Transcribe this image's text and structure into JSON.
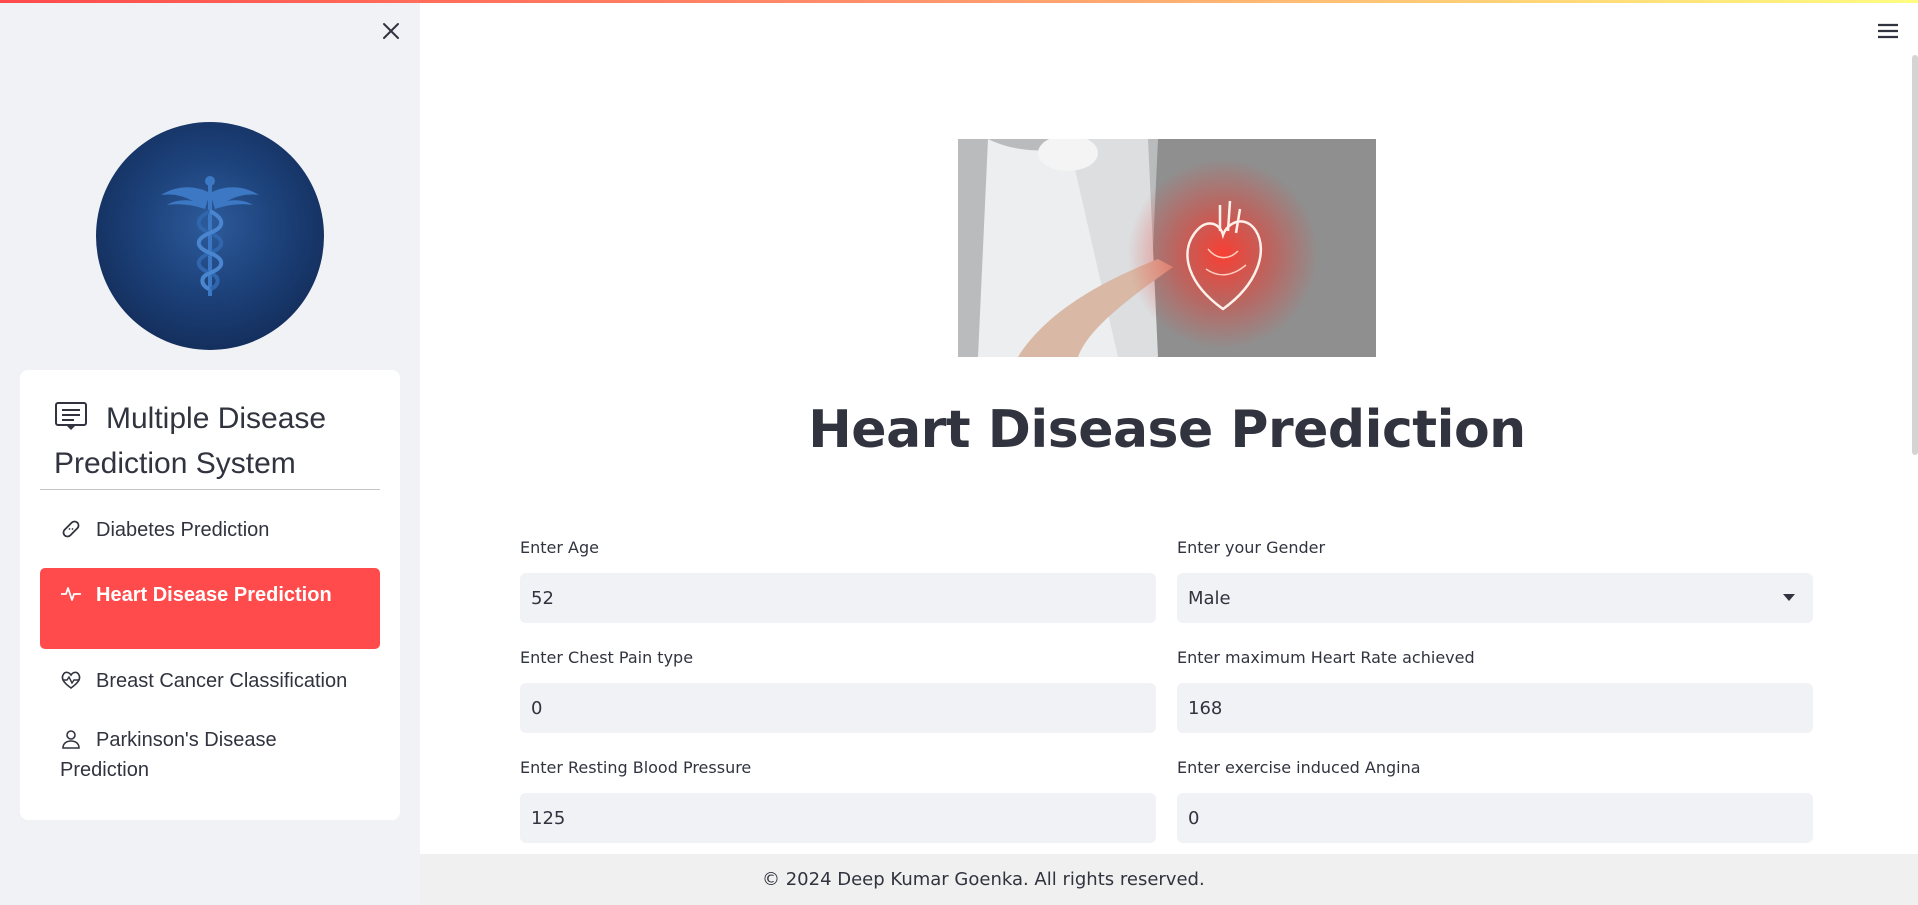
{
  "sidebar": {
    "logo_icon": "caduceus-icon",
    "close_icon": "close-icon",
    "menu_title": "Multiple Disease Prediction System",
    "menu_title_icon": "list-icon",
    "items": [
      {
        "label": "Diabetes Prediction",
        "icon": "bandage-icon",
        "active": false
      },
      {
        "label": "Heart Disease Prediction",
        "icon": "activity-icon",
        "active": true
      },
      {
        "label": "Breast Cancer Classification",
        "icon": "heart-pulse-icon",
        "active": false
      },
      {
        "label": "Parkinson's Disease Prediction",
        "icon": "person-icon",
        "active": false
      }
    ]
  },
  "header": {
    "menu_icon": "hamburger-icon"
  },
  "main": {
    "title": "Heart Disease Prediction",
    "fields": {
      "age": {
        "label": "Enter Age",
        "value": "52"
      },
      "gender": {
        "label": "Enter your Gender",
        "value": "Male"
      },
      "chest_pain": {
        "label": "Enter Chest Pain type",
        "value": "0"
      },
      "max_hr": {
        "label": "Enter maximum Heart Rate achieved",
        "value": "168"
      },
      "resting_bp": {
        "label": "Enter Resting Blood Pressure",
        "value": "125"
      },
      "angina": {
        "label": "Enter exercise induced Angina",
        "value": "0"
      }
    }
  },
  "footer": {
    "text": "© 2024 Deep Kumar Goenka. All rights reserved."
  },
  "colors": {
    "accent": "#ff4b4b",
    "sidebar_bg": "#f0f2f6",
    "input_bg": "#f0f2f6",
    "text": "#31333f"
  }
}
